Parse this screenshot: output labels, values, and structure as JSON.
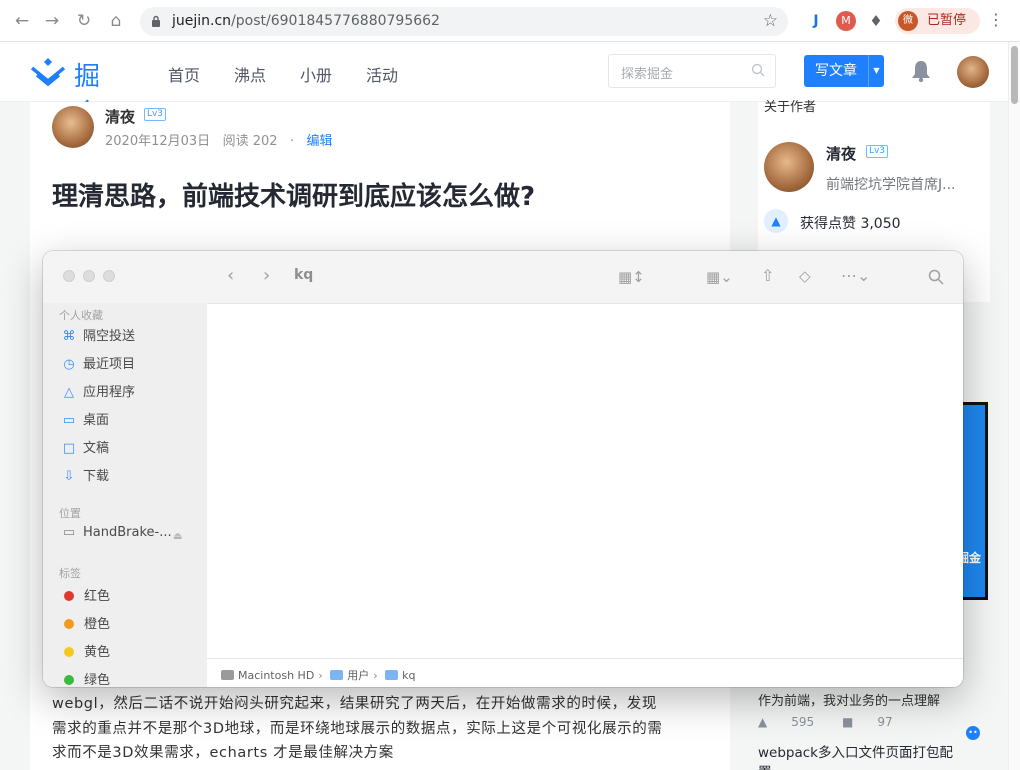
{
  "browser": {
    "url_host": "juejin.cn",
    "url_path": "/post/6901845776880795662",
    "profile_status": "已暂停",
    "profile_initial": "微",
    "ext_j": "J",
    "ext_m": "M"
  },
  "header": {
    "logo_text": "掘金",
    "nav": [
      "首页",
      "沸点",
      "小册",
      "活动"
    ],
    "search_placeholder": "探索掘金",
    "write_button": "写文章"
  },
  "article": {
    "author_name": "清夜",
    "level": "Lv3",
    "date": "2020年12月03日",
    "reads": "阅读 202",
    "dot": "·",
    "edit": "编辑",
    "title": "理清思路，前端技术调研到底应该怎么做?",
    "body_lines": [
      "webgl，然后二话不说开始闷头研究起来，结果研究了两天后，在开始做需求的时候，发现",
      "需求的重点并不是那个3D地球，而是环绕地球展示的数据点，实际上这是个可视化展示的需",
      "求而不是3D效果需求，echarts 才是最佳解决方案"
    ]
  },
  "sidebar": {
    "heading": "关于作者",
    "author_name": "清夜",
    "level": "Lv3",
    "author_desc": "前端挖坑学院首席J...",
    "likes": "获得点赞 3,050",
    "banner_text": "掘金"
  },
  "related": {
    "item1_title": "作为前端，我对业务的一点理解",
    "item1_likes": "595",
    "item1_comments": "97",
    "item2_title": "webpack多入口文件页面打包配置"
  },
  "finder": {
    "title": "kq",
    "sections": {
      "favorites": "个人收藏",
      "locations": "位置",
      "tags": "标签"
    },
    "favorites": [
      {
        "label": "隔空投送",
        "icon": "airdrop-icon"
      },
      {
        "label": "最近项目",
        "icon": "clock-icon"
      },
      {
        "label": "应用程序",
        "icon": "applications-icon"
      },
      {
        "label": "桌面",
        "icon": "desktop-icon"
      },
      {
        "label": "文稿",
        "icon": "document-icon"
      },
      {
        "label": "下载",
        "icon": "download-icon"
      }
    ],
    "locations": [
      {
        "label": "HandBrake-...",
        "icon": "disk-icon"
      }
    ],
    "tags": [
      {
        "label": "红色",
        "color": "#e0382f"
      },
      {
        "label": "橙色",
        "color": "#f39a1e"
      },
      {
        "label": "黄色",
        "color": "#f6c71d"
      },
      {
        "label": "绿色",
        "color": "#3bbb3e"
      }
    ],
    "path": [
      "Macintosh HD",
      "用户",
      "kq"
    ],
    "path_sep": "›"
  }
}
